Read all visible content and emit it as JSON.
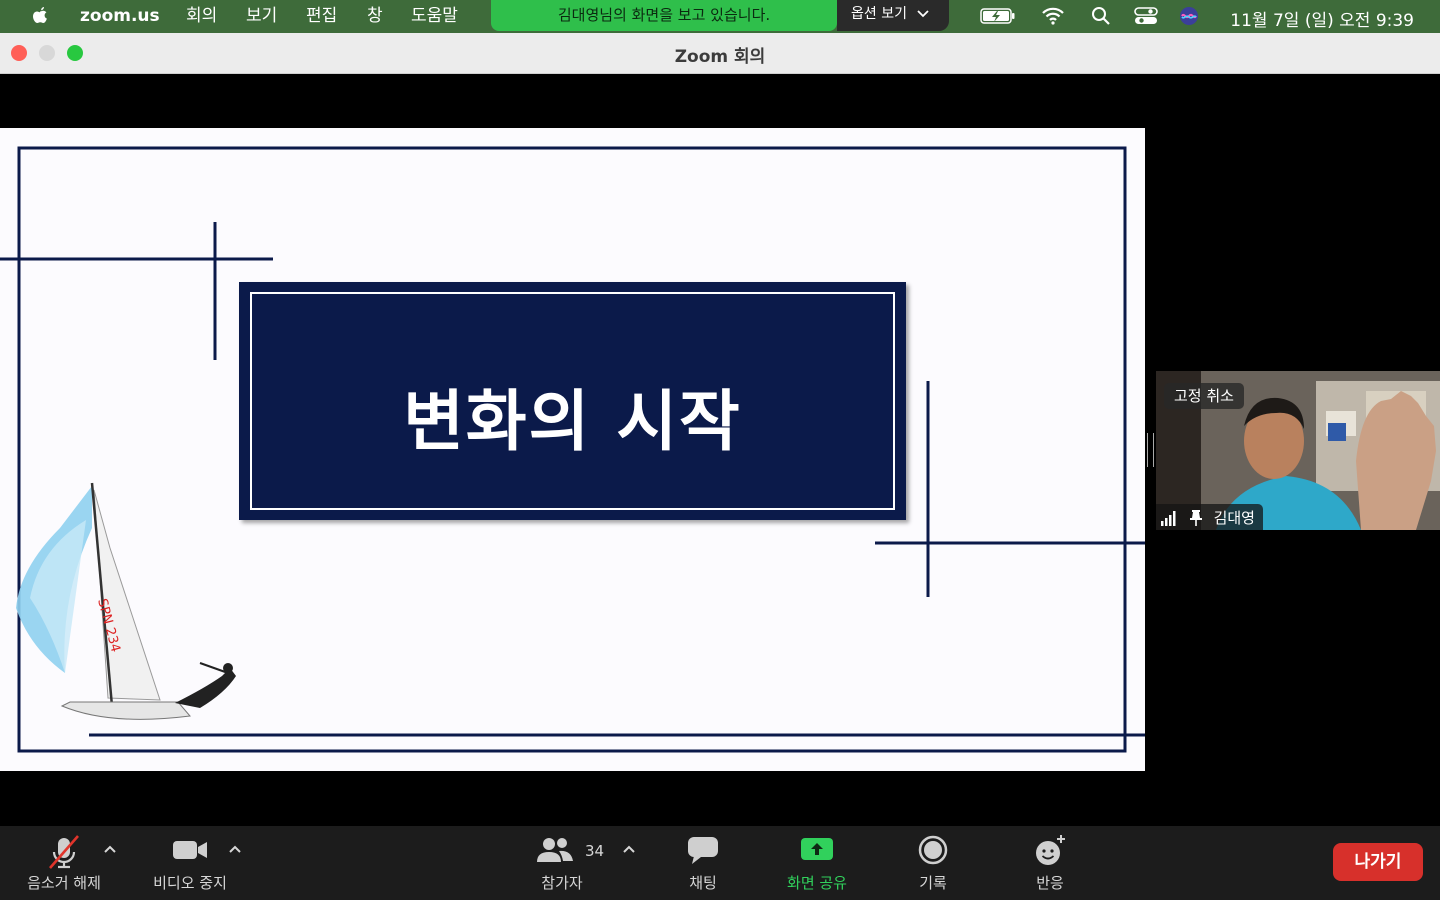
{
  "menubar": {
    "app_name": "zoom.us",
    "menus": [
      "회의",
      "보기",
      "편집",
      "창",
      "도움말"
    ],
    "share_banner": "김대영님의 화면을 보고 있습니다.",
    "options_label": "옵션 보기",
    "clock": "11월 7일 (일) 오전 9:39"
  },
  "window": {
    "title": "Zoom 회의"
  },
  "slide": {
    "title": "변화의 시작",
    "sail_number": "SPN 234"
  },
  "video": {
    "unpin_label": "고정 취소",
    "participant_name": "김대영"
  },
  "toolbar": {
    "mute_label": "음소거 해제",
    "video_label": "비디오 중지",
    "participants_label": "참가자",
    "participants_count": "34",
    "chat_label": "채팅",
    "share_label": "화면 공유",
    "record_label": "기록",
    "reactions_label": "반응",
    "leave_label": "나가기"
  },
  "colors": {
    "menubar_bg": "#3e6b3a",
    "share_green": "#31d15c",
    "leave_red": "#d7302b",
    "slide_navy": "#0b1a4a"
  }
}
